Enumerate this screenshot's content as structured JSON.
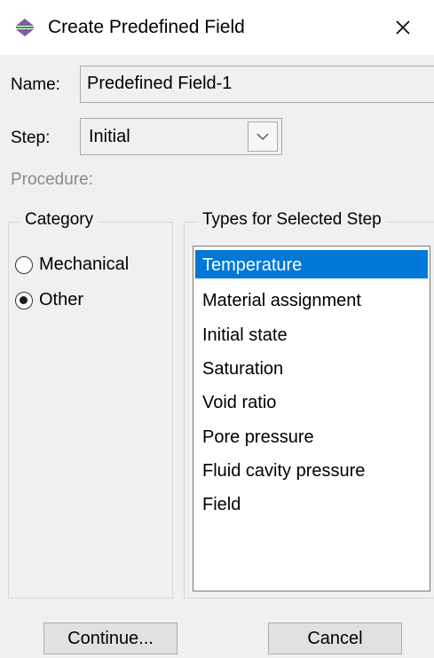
{
  "window": {
    "title": "Create Predefined Field",
    "icon": "predefined-field-icon",
    "close_icon": "close-icon"
  },
  "form": {
    "name_label": "Name:",
    "name_value": "Predefined Field-1",
    "step_label": "Step:",
    "step_value": "Initial",
    "procedure_label": "Procedure:"
  },
  "category": {
    "title": "Category",
    "options": [
      {
        "label": "Mechanical",
        "selected": false
      },
      {
        "label": "Other",
        "selected": true
      }
    ]
  },
  "types": {
    "title": "Types for Selected Step",
    "items": [
      "Temperature",
      "Material assignment",
      "Initial state",
      "Saturation",
      "Void ratio",
      "Pore pressure",
      "Fluid cavity pressure",
      "Field"
    ],
    "selected": "Temperature"
  },
  "buttons": {
    "continue": "Continue...",
    "cancel": "Cancel"
  },
  "colors": {
    "selection": "#0078d7",
    "dialog_bg": "#f0f0f0",
    "icon_purple": "#7b5aa6",
    "icon_green": "#2e9b3a"
  }
}
